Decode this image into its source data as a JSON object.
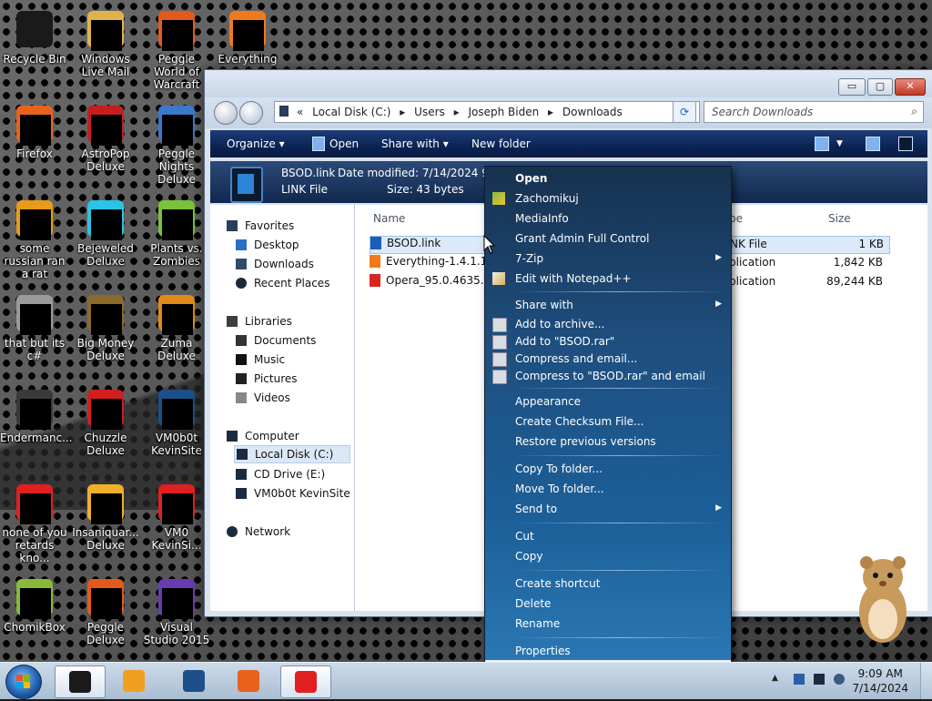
{
  "desktop": {
    "icons": [
      {
        "label": "Recycle Bin",
        "icon": "recycle-bin-icon",
        "color": "#1a1a1a"
      },
      {
        "label": "Windows Live Mail",
        "icon": "mail-icon",
        "color": "#e0b34a"
      },
      {
        "label": "Peggle World of Warcraft",
        "icon": "peggle-wow-icon",
        "color": "#e25a1c"
      },
      {
        "label": "Everything",
        "icon": "everything-icon",
        "color": "#f07a1a"
      },
      {
        "label": "Firefox",
        "icon": "firefox-icon",
        "color": "#e8621c"
      },
      {
        "label": "AstroPop Deluxe",
        "icon": "astropop-icon",
        "color": "#c41e1e"
      },
      {
        "label": "Peggle Nights Deluxe",
        "icon": "peggle-nights-icon",
        "color": "#3a78c9"
      },
      {
        "label": "some russian ran a rat",
        "icon": "app-icon",
        "color": "#e89a1a"
      },
      {
        "label": "Bejeweled Deluxe",
        "icon": "bejeweled-icon",
        "color": "#2ac4e6"
      },
      {
        "label": "Plants vs. Zombies",
        "icon": "pvz-icon",
        "color": "#7ac23a"
      },
      {
        "label": "that but its c#",
        "icon": "app-icon",
        "color": "#9a9a9a"
      },
      {
        "label": "Big Money Deluxe",
        "icon": "bigmoney-icon",
        "color": "#8b6a2a"
      },
      {
        "label": "Zuma Deluxe",
        "icon": "zuma-icon",
        "color": "#e08a1a"
      },
      {
        "label": "Endermanc...",
        "icon": "app-icon",
        "color": "#3a3a3a"
      },
      {
        "label": "Chuzzle Deluxe",
        "icon": "chuzzle-icon",
        "color": "#d11e1e"
      },
      {
        "label": "VM0b0t KevinSite",
        "icon": "vm-icon",
        "color": "#1d4f8a"
      },
      {
        "label": "none of you retards kno...",
        "icon": "opera-icon",
        "color": "#e02020"
      },
      {
        "label": "Insaniquar... Deluxe",
        "icon": "insaniquarium-icon",
        "color": "#f0b02a"
      },
      {
        "label": "VM0 KevinSi...",
        "icon": "opera-icon",
        "color": "#e02020"
      },
      {
        "label": "ChomikBox",
        "icon": "chomikbox-icon",
        "color": "#8ab83a"
      },
      {
        "label": "Peggle Deluxe",
        "icon": "peggle-icon",
        "color": "#e25a1c"
      },
      {
        "label": "Visual Studio 2015",
        "icon": "visual-studio-icon",
        "color": "#6a3ab0"
      }
    ]
  },
  "window": {
    "controls": {
      "minimize": "▭",
      "maximize": "▢",
      "close": "✕"
    },
    "breadcrumb": [
      "«",
      "Local Disk (C:)",
      "▸",
      "Users",
      "▸",
      "Joseph Biden",
      "▸",
      "Downloads"
    ],
    "search_placeholder": "Search Downloads",
    "toolbar": {
      "organize": "Organize ▾",
      "open": "Open",
      "share": "Share with ▾",
      "new_folder": "New folder"
    },
    "details": {
      "name": "BSOD.link",
      "modified_label": "Date modified: 7/14/2024 9:08",
      "type": "LINK File",
      "size_label": "Size: 43 bytes"
    },
    "nav": {
      "favorites": "Favorites",
      "desktop": "Desktop",
      "downloads": "Downloads",
      "recent": "Recent Places",
      "libraries": "Libraries",
      "documents": "Documents",
      "music": "Music",
      "pictures": "Pictures",
      "videos": "Videos",
      "computer": "Computer",
      "local_disk": "Local Disk (C:)",
      "cd_drive": "CD Drive (E:)",
      "vm_site": "VM0b0t KevinSite",
      "network": "Network"
    },
    "columns": {
      "name": "Name",
      "type": "pe",
      "size": "Size"
    },
    "files": [
      {
        "name": "BSOD.link",
        "type": "NK File",
        "size": "1 KB",
        "color": "#1a5fb4"
      },
      {
        "name": "Everything-1.4.1.10",
        "type": "plication",
        "size": "1,842 KB",
        "color": "#f07a1a"
      },
      {
        "name": "Opera_95.0.4635.90",
        "type": "plication",
        "size": "89,244 KB",
        "color": "#d92424"
      }
    ]
  },
  "context_menu": {
    "open": "Open",
    "zachomikuj": "Zachomikuj",
    "mediainfo": "MediaInfo",
    "grant_admin": "Grant Admin Full Control",
    "seven_zip": "7-Zip",
    "edit_npp": "Edit with Notepad++",
    "share_with": "Share with",
    "add_archive": "Add to archive...",
    "add_rar": "Add to \"BSOD.rar\"",
    "compress_email": "Compress and email...",
    "compress_rar_email": "Compress to \"BSOD.rar\" and email",
    "appearance": "Appearance",
    "checksum": "Create Checksum File...",
    "restore": "Restore previous versions",
    "copy_to": "Copy To folder...",
    "move_to": "Move To folder...",
    "send_to": "Send to",
    "cut": "Cut",
    "copy": "Copy",
    "create_shortcut": "Create shortcut",
    "delete": "Delete",
    "rename": "Rename",
    "properties": "Properties"
  },
  "taskbar": {
    "apps": [
      {
        "name": "explorer-app",
        "icon": "explorer-icon",
        "color": "#1a1a1a",
        "active": true
      },
      {
        "name": "media-player-app",
        "icon": "media-player-icon",
        "color": "#f0a020",
        "active": false
      },
      {
        "name": "globe-app",
        "icon": "globe-icon",
        "color": "#1d4f8a",
        "active": false
      },
      {
        "name": "firefox-app",
        "icon": "firefox-icon",
        "color": "#e8621c",
        "active": false
      },
      {
        "name": "opera-app",
        "icon": "opera-icon",
        "color": "#e02020",
        "active": true
      }
    ],
    "time": "9:09 AM",
    "date": "7/14/2024"
  }
}
